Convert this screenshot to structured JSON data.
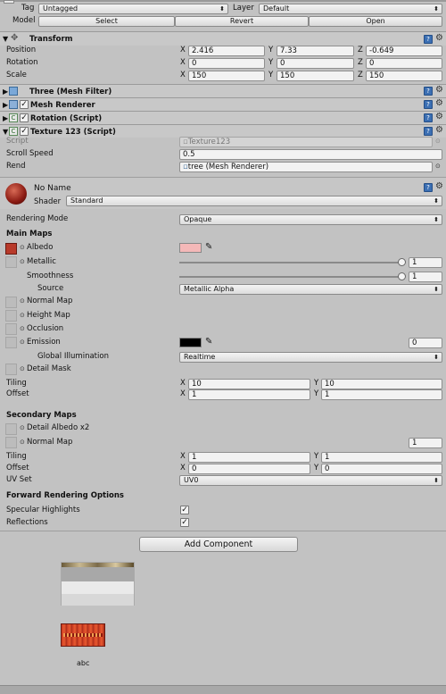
{
  "top": {
    "tag_label": "Tag",
    "tag_value": "Untagged",
    "layer_label": "Layer",
    "layer_value": "Default",
    "model_label": "Model",
    "select_btn": "Select",
    "revert_btn": "Revert",
    "open_btn": "Open"
  },
  "transform": {
    "title": "Transform",
    "position_label": "Position",
    "rotation_label": "Rotation",
    "scale_label": "Scale",
    "x": "X",
    "y": "Y",
    "z": "Z",
    "position": [
      "2.416",
      "7.33",
      "-0.649"
    ],
    "rotation": [
      "0",
      "0",
      "0"
    ],
    "scale": [
      "150",
      "150",
      "150"
    ]
  },
  "components": [
    {
      "title": "Three (Mesh Filter)"
    },
    {
      "title": "Mesh Renderer"
    },
    {
      "title": "Rotation (Script)"
    },
    {
      "title": "Texture 123 (Script)"
    }
  ],
  "texture_script": {
    "script_label": "Script",
    "script_value": "Texture123",
    "scroll_label": "Scroll Speed",
    "scroll_value": "0.5",
    "rend_label": "Rend",
    "rend_value": "tree (Mesh Renderer)"
  },
  "material": {
    "name": "No Name",
    "shader_label": "Shader",
    "shader_value": "Standard",
    "rendering_mode_label": "Rendering Mode",
    "rendering_mode_value": "Opaque",
    "main_maps": "Main Maps",
    "albedo": "Albedo",
    "metallic": "Metallic",
    "metallic_value": "1",
    "smoothness": "Smoothness",
    "smoothness_value": "1",
    "source": "Source",
    "source_value": "Metallic Alpha",
    "normal_map": "Normal Map",
    "height_map": "Height Map",
    "occlusion": "Occlusion",
    "emission": "Emission",
    "emission_value": "0",
    "gi_label": "Global Illumination",
    "gi_value": "Realtime",
    "detail_mask": "Detail Mask",
    "tiling": "Tiling",
    "offset": "Offset",
    "x": "X",
    "y": "Y",
    "main_tiling": [
      "10",
      "10"
    ],
    "main_offset": [
      "1",
      "1"
    ],
    "secondary_maps": "Secondary Maps",
    "detail_albedo": "Detail Albedo x2",
    "sec_normal_map": "Normal Map",
    "sec_normal_value": "1",
    "sec_tiling": [
      "1",
      "1"
    ],
    "sec_offset": [
      "0",
      "0"
    ],
    "uvset_label": "UV Set",
    "uvset_value": "UV0",
    "forward_label": "Forward Rendering Options",
    "specular_label": "Specular Highlights",
    "reflections_label": "Reflections",
    "check_mark": "✓"
  },
  "add_component": "Add Component",
  "assets": {
    "abc_label": "abc"
  },
  "icons": {
    "help": "?",
    "gear": "⚙",
    "dot": "⊙",
    "arrow": "▾",
    "picker": "eyedropper-icon"
  },
  "colors": {
    "albedo_swatch": "#f4b8b8",
    "emission_swatch": "#000000",
    "albedo_tex": "#b83a2a"
  }
}
